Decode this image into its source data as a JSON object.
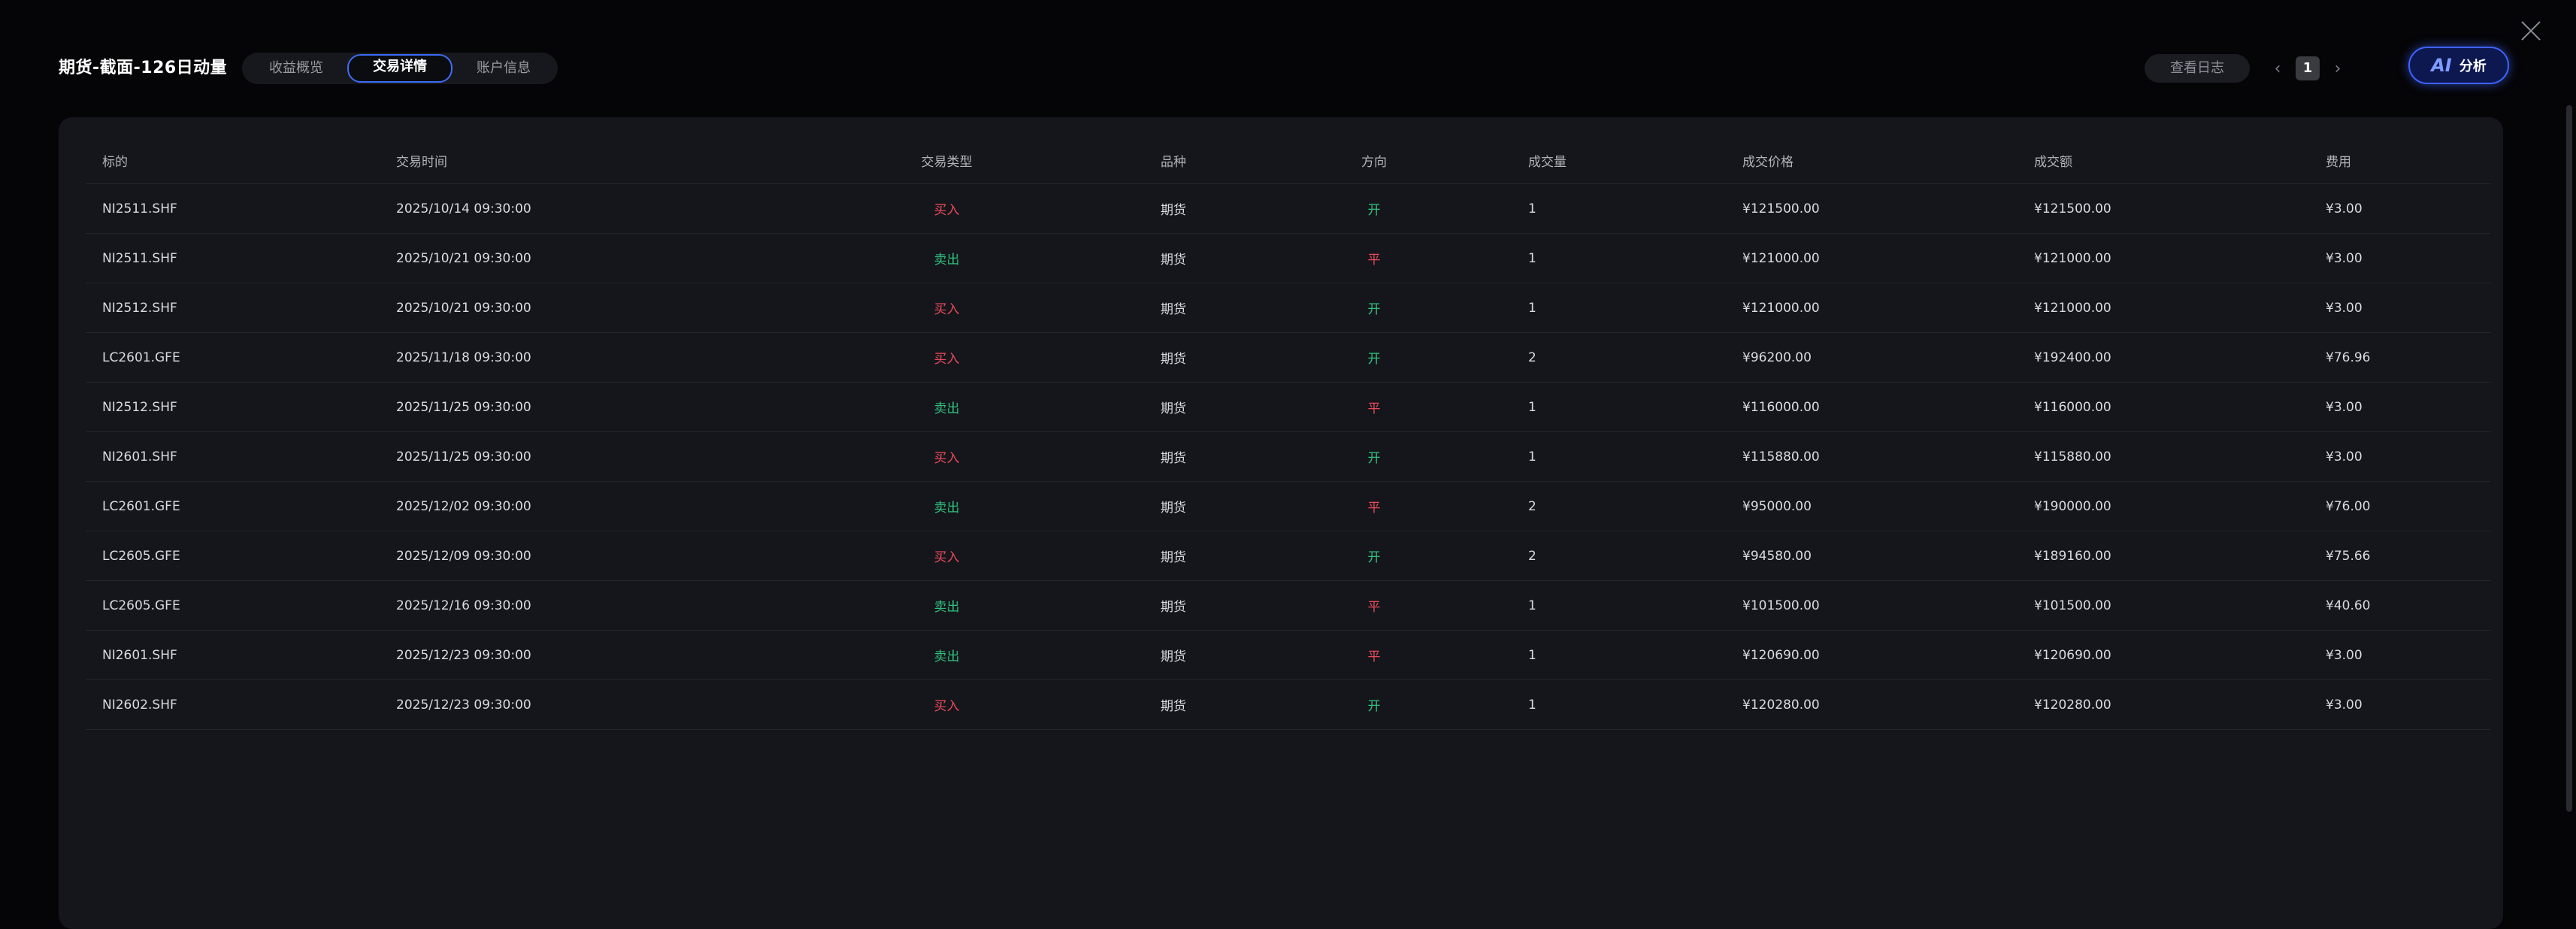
{
  "header": {
    "title": "期货-截面-126日动量",
    "tabs": [
      {
        "label": "收益概览",
        "active": false
      },
      {
        "label": "交易详情",
        "active": true
      },
      {
        "label": "账户信息",
        "active": false
      }
    ],
    "log_button": "查看日志",
    "pager": {
      "prev": "‹",
      "page": "1",
      "next": "›"
    },
    "ai_button": {
      "icon": "AI",
      "label": "分析"
    }
  },
  "colors": {
    "buy": "#e94a5b",
    "sell": "#2fc07e",
    "accent": "#3b6ef5"
  },
  "table": {
    "columns": [
      "标的",
      "交易时间",
      "交易类型",
      "品种",
      "方向",
      "成交量",
      "成交价格",
      "成交额",
      "费用"
    ],
    "rows": [
      {
        "symbol": "NI2511.SHF",
        "time": "2025/10/14 09:30:00",
        "type": "买入",
        "kind": "期货",
        "dir": "开",
        "qty": "1",
        "price": "¥121500.00",
        "amount": "¥121500.00",
        "fee": "¥3.00"
      },
      {
        "symbol": "NI2511.SHF",
        "time": "2025/10/21 09:30:00",
        "type": "卖出",
        "kind": "期货",
        "dir": "平",
        "qty": "1",
        "price": "¥121000.00",
        "amount": "¥121000.00",
        "fee": "¥3.00"
      },
      {
        "symbol": "NI2512.SHF",
        "time": "2025/10/21 09:30:00",
        "type": "买入",
        "kind": "期货",
        "dir": "开",
        "qty": "1",
        "price": "¥121000.00",
        "amount": "¥121000.00",
        "fee": "¥3.00"
      },
      {
        "symbol": "LC2601.GFE",
        "time": "2025/11/18 09:30:00",
        "type": "买入",
        "kind": "期货",
        "dir": "开",
        "qty": "2",
        "price": "¥96200.00",
        "amount": "¥192400.00",
        "fee": "¥76.96"
      },
      {
        "symbol": "NI2512.SHF",
        "time": "2025/11/25 09:30:00",
        "type": "卖出",
        "kind": "期货",
        "dir": "平",
        "qty": "1",
        "price": "¥116000.00",
        "amount": "¥116000.00",
        "fee": "¥3.00"
      },
      {
        "symbol": "NI2601.SHF",
        "time": "2025/11/25 09:30:00",
        "type": "买入",
        "kind": "期货",
        "dir": "开",
        "qty": "1",
        "price": "¥115880.00",
        "amount": "¥115880.00",
        "fee": "¥3.00"
      },
      {
        "symbol": "LC2601.GFE",
        "time": "2025/12/02 09:30:00",
        "type": "卖出",
        "kind": "期货",
        "dir": "平",
        "qty": "2",
        "price": "¥95000.00",
        "amount": "¥190000.00",
        "fee": "¥76.00"
      },
      {
        "symbol": "LC2605.GFE",
        "time": "2025/12/09 09:30:00",
        "type": "买入",
        "kind": "期货",
        "dir": "开",
        "qty": "2",
        "price": "¥94580.00",
        "amount": "¥189160.00",
        "fee": "¥75.66"
      },
      {
        "symbol": "LC2605.GFE",
        "time": "2025/12/16 09:30:00",
        "type": "卖出",
        "kind": "期货",
        "dir": "平",
        "qty": "1",
        "price": "¥101500.00",
        "amount": "¥101500.00",
        "fee": "¥40.60"
      },
      {
        "symbol": "NI2601.SHF",
        "time": "2025/12/23 09:30:00",
        "type": "卖出",
        "kind": "期货",
        "dir": "平",
        "qty": "1",
        "price": "¥120690.00",
        "amount": "¥120690.00",
        "fee": "¥3.00"
      },
      {
        "symbol": "NI2602.SHF",
        "time": "2025/12/23 09:30:00",
        "type": "买入",
        "kind": "期货",
        "dir": "开",
        "qty": "1",
        "price": "¥120280.00",
        "amount": "¥120280.00",
        "fee": "¥3.00"
      }
    ]
  }
}
